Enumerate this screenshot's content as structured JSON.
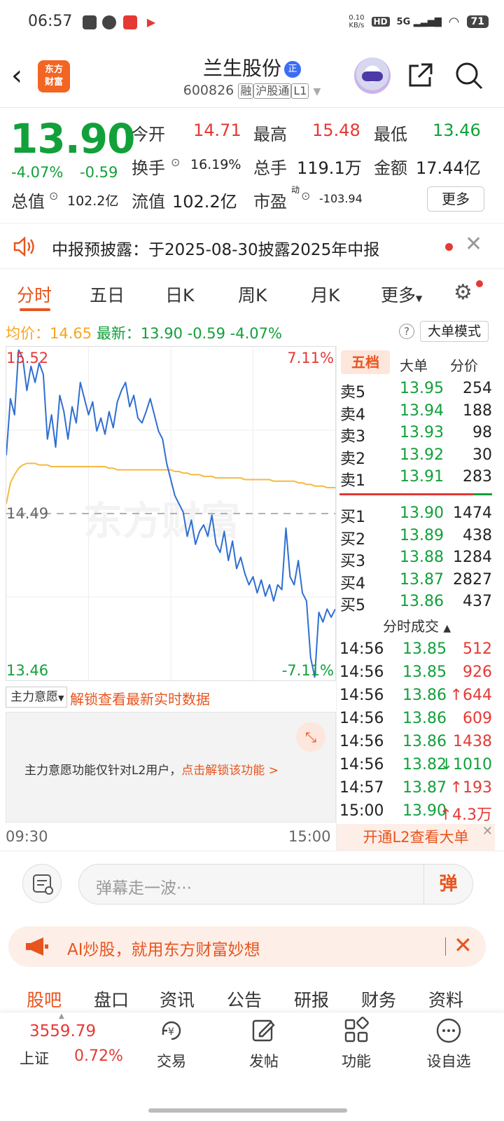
{
  "status_bar": {
    "time": "06:57",
    "net_speed_top": "0.10",
    "net_speed_unit": "KB/s",
    "hd": "HD",
    "signal": "5G",
    "battery": "71"
  },
  "header": {
    "logo_line1": "东方",
    "logo_line2": "财富",
    "title": "兰生股份",
    "title_badge": "正",
    "code": "600826",
    "tags": [
      "融",
      "沪股通",
      "L1"
    ]
  },
  "quote": {
    "price": "13.90",
    "change_pct": "-4.07%",
    "change": "-0.59",
    "open_label": "今开",
    "open": "14.71",
    "high_label": "最高",
    "high": "15.48",
    "low_label": "最低",
    "low": "13.46",
    "turnover_label": "换手",
    "turnover": "16.19%",
    "volume_label": "总手",
    "volume": "119.1万",
    "amount_label": "金额",
    "amount": "17.44亿",
    "mktcap_label": "总值",
    "mktcap": "102.2亿",
    "float_label": "流值",
    "float": "102.2亿",
    "pe_label": "市盈",
    "pe_sup": "动",
    "pe": "-103.94",
    "more": "更多"
  },
  "notice": {
    "text": "中报预披露：于2025-08-30披露2025年中报"
  },
  "tabs": [
    "分时",
    "五日",
    "日K",
    "周K",
    "月K",
    "更多"
  ],
  "info": {
    "avg_label": "均价：",
    "avg": "14.65",
    "latest_label": "最新：",
    "latest": "13.90",
    "change": "-0.59",
    "change_pct": "-4.07%",
    "big_mode": "大单模式"
  },
  "chart_data": {
    "type": "line",
    "xlabel": "",
    "ylabel": "",
    "ylim": [
      13.46,
      15.52
    ],
    "y_top_label": "15.52",
    "y_bottom_label": "13.46",
    "y_mid_label": "14.49",
    "pct_top_label": "7.11%",
    "pct_bottom_label": "-7.11%",
    "x_start": "09:30",
    "x_end": "15:00",
    "watermark": "东方财富",
    "series": [
      {
        "values": [
          14.85,
          15.2,
          15.1,
          15.5,
          15.45,
          15.25,
          15.4,
          15.3,
          15.42,
          15.35,
          14.95,
          15.1,
          14.9,
          15.22,
          15.12,
          14.95,
          15.15,
          15.05,
          15.3,
          15.2,
          15.1,
          15.18,
          15.0,
          15.08,
          14.98,
          15.12,
          15.02,
          15.18,
          15.25,
          15.3,
          15.15,
          15.22,
          15.08,
          15.05,
          15.12,
          15.2,
          15.1,
          15.0,
          14.95,
          14.8,
          14.7,
          14.6,
          14.55,
          14.5,
          14.35,
          14.45,
          14.3,
          14.38,
          14.42,
          14.35,
          14.48,
          14.3,
          14.25,
          14.38,
          14.2,
          14.32,
          14.15,
          14.22,
          14.12,
          14.05,
          14.1,
          14.0,
          14.08,
          13.98,
          14.05,
          13.95,
          14.05,
          14.02,
          14.4,
          14.1,
          14.05,
          14.2,
          14.0,
          13.95,
          13.6,
          13.48,
          13.88,
          13.82,
          13.9,
          13.85,
          13.9
        ]
      },
      {
        "values": [
          14.55,
          14.68,
          14.73,
          14.77,
          14.79,
          14.8,
          14.8,
          14.8,
          14.79,
          14.79,
          14.79,
          14.78,
          14.78,
          14.78,
          14.78,
          14.78,
          14.78,
          14.78,
          14.78,
          14.78,
          14.78,
          14.78,
          14.78,
          14.78,
          14.78,
          14.77,
          14.77,
          14.76,
          14.76,
          14.76,
          14.76,
          14.76,
          14.76,
          14.76,
          14.76,
          14.76,
          14.76,
          14.76,
          14.76,
          14.76,
          14.76,
          14.75,
          14.75,
          14.74,
          14.74,
          14.73,
          14.73,
          14.73,
          14.72,
          14.72,
          14.72,
          14.71,
          14.71,
          14.71,
          14.71,
          14.71,
          14.71,
          14.71,
          14.7,
          14.7,
          14.7,
          14.7,
          14.7,
          14.7,
          14.7,
          14.69,
          14.69,
          14.69,
          14.69,
          14.69,
          14.69,
          14.68,
          14.68,
          14.67,
          14.67,
          14.66,
          14.66,
          14.66,
          14.65,
          14.65,
          14.65
        ]
      }
    ]
  },
  "main_force": {
    "label": "主力意愿",
    "unlock": "解锁查看最新实时数据",
    "panel_msg": "主力意愿功能仅针对L2用户，",
    "panel_link": "点击解锁该功能 >"
  },
  "book": {
    "tabs": [
      "五档",
      "大单",
      "分价"
    ],
    "asks": [
      {
        "label": "卖5",
        "price": "13.95",
        "vol": "254"
      },
      {
        "label": "卖4",
        "price": "13.94",
        "vol": "188"
      },
      {
        "label": "卖3",
        "price": "13.93",
        "vol": "98"
      },
      {
        "label": "卖2",
        "price": "13.92",
        "vol": "30"
      },
      {
        "label": "卖1",
        "price": "13.91",
        "vol": "283"
      }
    ],
    "bids": [
      {
        "label": "买1",
        "price": "13.90",
        "vol": "1474"
      },
      {
        "label": "买2",
        "price": "13.89",
        "vol": "438"
      },
      {
        "label": "买3",
        "price": "13.88",
        "vol": "1284"
      },
      {
        "label": "买4",
        "price": "13.87",
        "vol": "2827"
      },
      {
        "label": "买5",
        "price": "13.86",
        "vol": "437"
      }
    ],
    "ticks_title": "分时成交",
    "ticks": [
      {
        "time": "14:56",
        "price": "13.85",
        "vol": "512",
        "arrow": ""
      },
      {
        "time": "14:56",
        "price": "13.85",
        "vol": "926",
        "arrow": ""
      },
      {
        "time": "14:56",
        "price": "13.86",
        "vol": "644",
        "arrow": "↑"
      },
      {
        "time": "14:56",
        "price": "13.86",
        "vol": "609",
        "arrow": ""
      },
      {
        "time": "14:56",
        "price": "13.86",
        "vol": "1438",
        "arrow": ""
      },
      {
        "time": "14:56",
        "price": "13.82",
        "vol": "1010",
        "arrow": "↓"
      },
      {
        "time": "14:57",
        "price": "13.87",
        "vol": "193",
        "arrow": "↑"
      },
      {
        "time": "15:00",
        "price": "13.90",
        "vol": "4.3万",
        "arrow": "↑"
      }
    ],
    "l2_button": "开通L2查看大单"
  },
  "comment": {
    "placeholder": "弹幕走一波···",
    "dan": "弹"
  },
  "ai_banner": {
    "text": "AI炒股，就用东方财富妙想"
  },
  "bottom_tabs": [
    "股吧",
    "盘口",
    "资讯",
    "公告",
    "研报",
    "财务",
    "资料"
  ],
  "footer": {
    "index_value": "3559.79",
    "index_name": "上证",
    "index_pct": "0.72%",
    "items": [
      "交易",
      "发帖",
      "功能",
      "设自选"
    ]
  },
  "colors": {
    "up": "#e53935",
    "down": "#12a03a",
    "accent": "#e8541e",
    "avg_line": "#f5b942",
    "price_line": "#2f6fd1"
  }
}
